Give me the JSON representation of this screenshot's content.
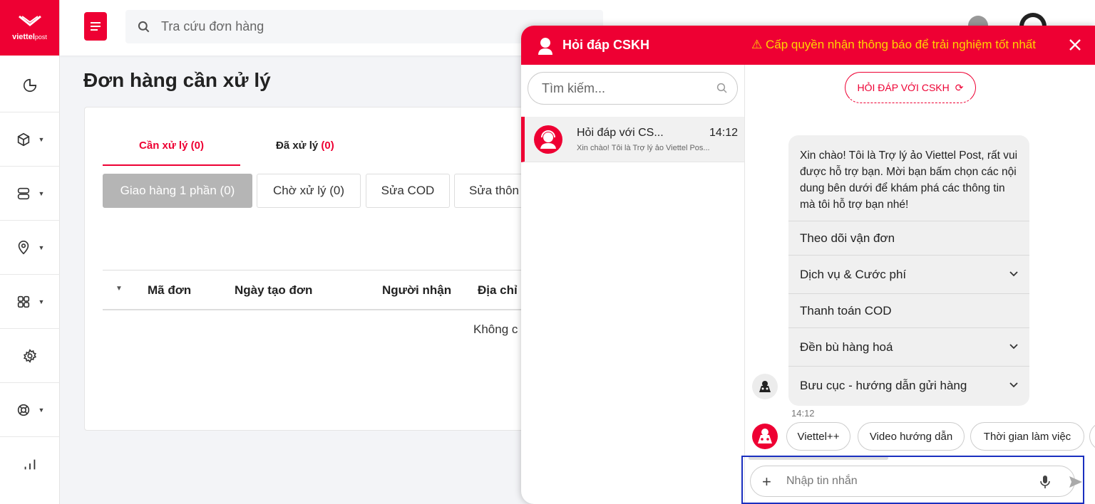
{
  "brand": {
    "logo_text": "viettel",
    "logo_suffix": "post",
    "accent": "#ee0033"
  },
  "header": {
    "search_placeholder": "Tra cứu đơn hàng"
  },
  "page": {
    "title": "Đơn hàng cần xử lý",
    "tabs": [
      {
        "label": "Cần xử lý",
        "count": "(0)"
      },
      {
        "label": "Đã xử lý",
        "count": "(0)"
      }
    ],
    "subtabs": [
      "Giao hàng 1 phần (0)",
      "Chờ xử lý (0)",
      "Sửa COD",
      "Sửa thôn"
    ],
    "table": {
      "columns": [
        "Mã đơn",
        "Ngày tạo đơn",
        "Người nhận",
        "Địa chỉ"
      ],
      "empty_text": "Không c"
    }
  },
  "chat": {
    "title": "Hỏi đáp CSKH",
    "warning": "⚠ Cấp quyền nhận thông báo để trải nghiệm tốt nhất",
    "search_placeholder": "Tìm kiếm...",
    "conversation": {
      "name": "Hỏi đáp với CS...",
      "time": "14:12",
      "preview": "Xin chào! Tôi là Trợ lý ảo Viettel Pos..."
    },
    "ask_button": "HỎI ĐÁP VỚI CSKH",
    "message": {
      "text": "Xin chào! Tôi là Trợ lý ảo Viettel Post, rất vui được hỗ trợ bạn. Mời bạn bấm chọn các nội dung bên dưới để khám phá các thông tin mà tôi hỗ trợ bạn nhé!",
      "options": [
        "Theo dõi vận đơn",
        "Dịch vụ & Cước phí",
        "Thanh toán COD",
        "Đền bù hàng hoá",
        "Bưu cục - hướng dẫn gửi hàng"
      ],
      "time": "14:12"
    },
    "quick_replies": [
      "Viettel++",
      "Video hướng dẫn",
      "Thời gian làm việc"
    ],
    "input_placeholder": "Nhập tin nhắn"
  }
}
